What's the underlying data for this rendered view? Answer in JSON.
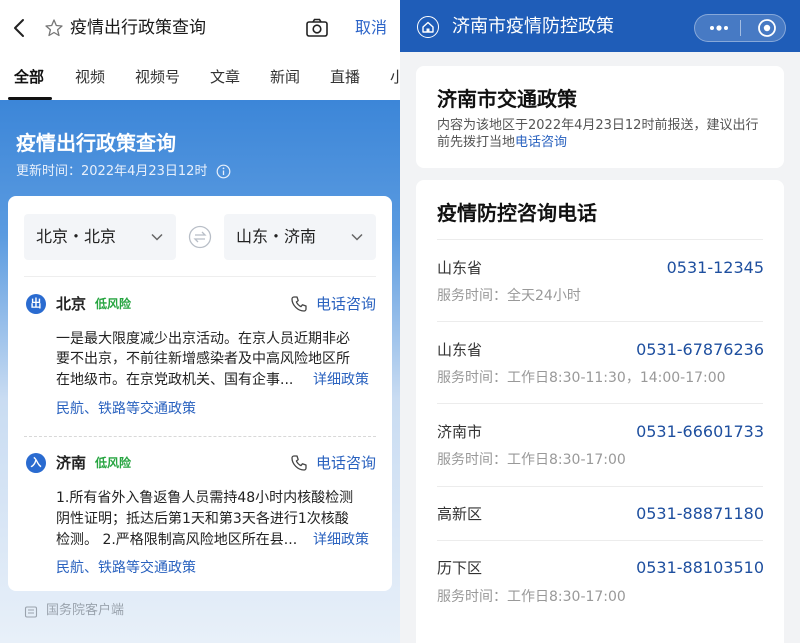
{
  "left": {
    "search": {
      "query": "疫情出行政策查询",
      "cancel_label": "取消"
    },
    "tabs": [
      {
        "label": "全部",
        "active": true
      },
      {
        "label": "视频"
      },
      {
        "label": "视频号"
      },
      {
        "label": "文章"
      },
      {
        "label": "新闻"
      },
      {
        "label": "直播"
      },
      {
        "label": "小"
      }
    ],
    "card": {
      "title": "疫情出行政策查询",
      "update_time": "更新时间：2022年4月23日12时",
      "from_city": "北京・北京",
      "to_city": "山东・济南"
    },
    "entries": [
      {
        "badge": "出",
        "city": "北京",
        "risk": "低风险",
        "phone_label": "电话咨询",
        "lines": [
          "一是最大限度减少出京活动。在京人员近期非必",
          "要不出京，不前往新增感染者及中高风险地区所",
          "在地级市。在京党政机关、国有企事..."
        ],
        "detail_label": "详细政策",
        "traffic_label": "民航、铁路等交通政策"
      },
      {
        "badge": "入",
        "city": "济南",
        "risk": "低风险",
        "phone_label": "电话咨询",
        "lines": [
          "1.所有省外入鲁返鲁人员需持48小时内核酸检测",
          "阴性证明；抵达后第1天和第3天各进行1次核酸",
          "检测。 2.严格限制高风险地区所在县..."
        ],
        "detail_label": "详细政策",
        "traffic_label": "民航、铁路等交通政策"
      }
    ],
    "footer": "国务院客户端"
  },
  "right": {
    "nav_title": "济南市疫情防控政策",
    "traffic": {
      "title": "济南市交通政策",
      "note_line1": "内容为该地区于2022年4月23日12时前报送，建议出行",
      "note_line2_prefix": "前先拨打当地",
      "note_link": "电话咨询"
    },
    "hotline": {
      "title": "疫情防控咨询电话",
      "items": [
        {
          "region": "山东省",
          "phone": "0531-12345",
          "hours": "服务时间：全天24小时"
        },
        {
          "region": "山东省",
          "phone": "0531-67876236",
          "hours": "服务时间：工作日8:30-11:30，14:00-17:00"
        },
        {
          "region": "济南市",
          "phone": "0531-66601733",
          "hours": "服务时间：工作日8:30-17:00"
        },
        {
          "region": "高新区",
          "phone": "0531-88871180",
          "hours": ""
        },
        {
          "region": "历下区",
          "phone": "0531-88103510",
          "hours": "服务时间：工作日8:30-17:00"
        }
      ]
    }
  },
  "colors": {
    "brand_blue": "#1f5db8",
    "link_blue": "#2a62bf",
    "risk_green": "#27a541"
  },
  "icons": [
    "back-icon",
    "star-icon",
    "camera-icon",
    "info-icon",
    "chevron-down-icon",
    "swap-icon",
    "phone-icon",
    "home-icon",
    "more-icon",
    "target-icon"
  ]
}
